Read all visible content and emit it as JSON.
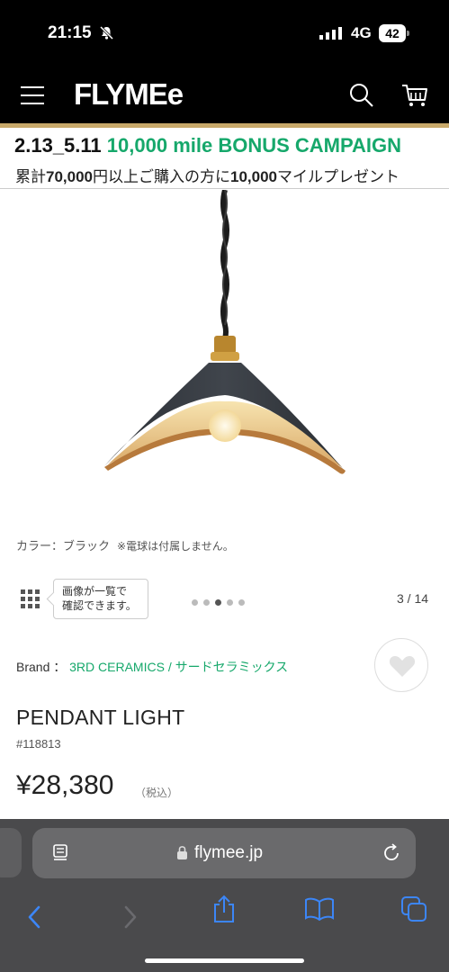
{
  "status_bar": {
    "time": "21:15",
    "network": "4G",
    "battery": "42"
  },
  "header": {
    "logo": "FLYMEe",
    "icons": [
      "menu-icon",
      "search-icon",
      "cart-icon"
    ]
  },
  "campaign": {
    "dates": "2.13_5.11",
    "title": "10,000 mile BONUS CAMPAIGN",
    "subtitle_parts": [
      "累計",
      "70,000",
      "円以上ご購入の方に",
      "10,000",
      "マイルプレゼント"
    ]
  },
  "product_note": {
    "color": "カラー：ブラック",
    "bulb": "※電球は付属しません。"
  },
  "gallery": {
    "tooltip_line1": "画像が一覧で",
    "tooltip_line2": "確認できます。",
    "dot_count": 5,
    "active_dot": 3,
    "pager": "3 / 14"
  },
  "product": {
    "brand_label": "Brand ：",
    "brand_link": "3RD CERAMICS / サードセラミックス",
    "name": "PENDANT LIGHT",
    "sku": "#118813",
    "price": "¥28,380",
    "tax": "（税込）"
  },
  "browser": {
    "url": "flymee.jp"
  },
  "colors": {
    "header_bg": "#000000",
    "accent_gold": "#c8a96a",
    "brand_green": "#16a86b",
    "safari_bar": "#4a4a4c"
  }
}
